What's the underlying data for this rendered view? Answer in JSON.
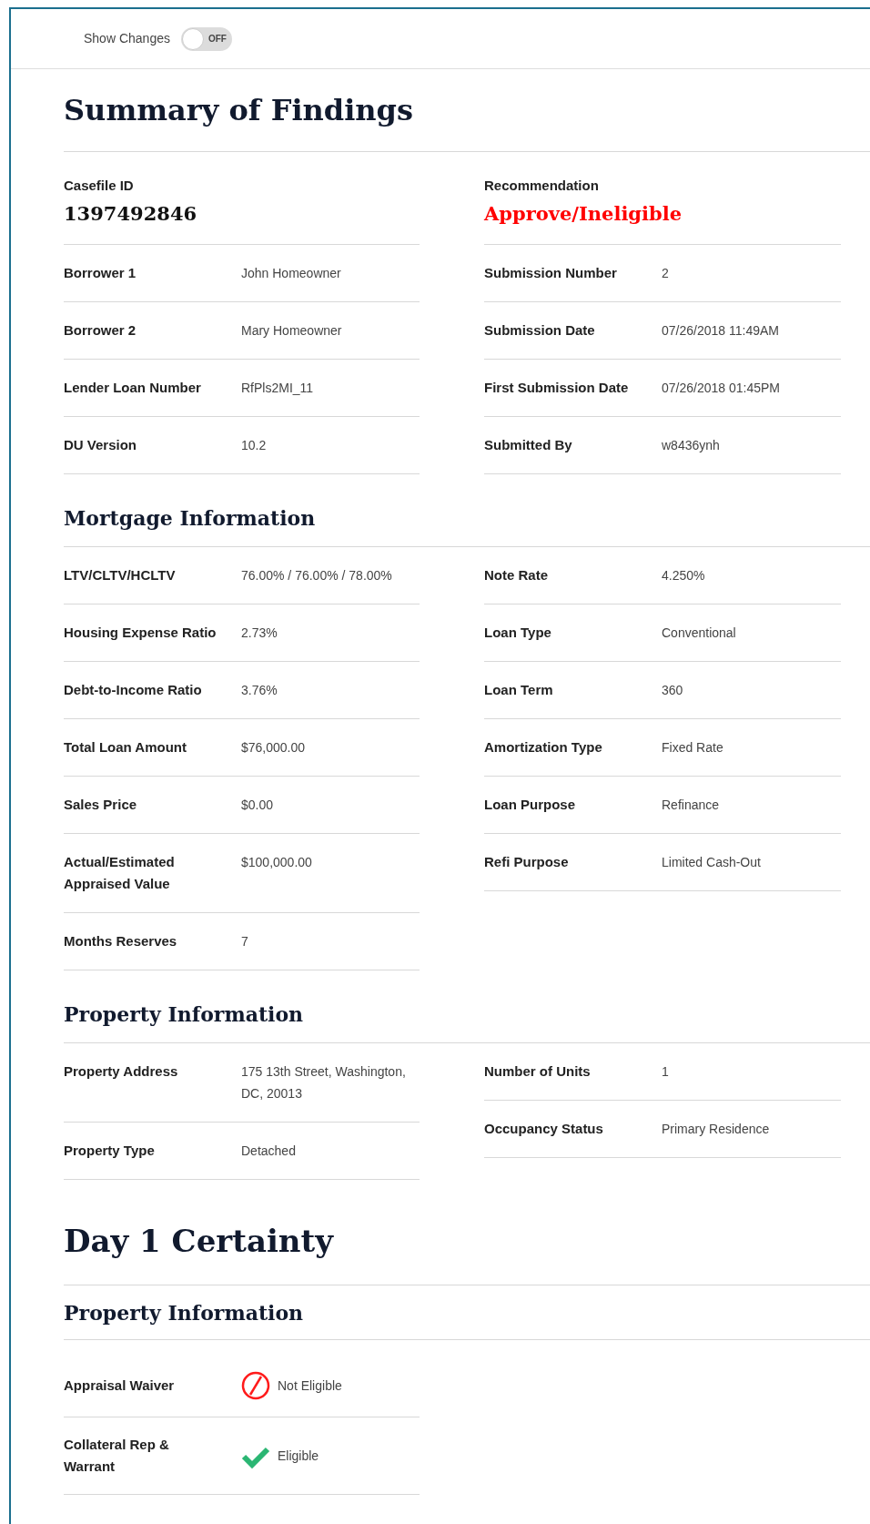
{
  "toggle": {
    "label": "Show Changes",
    "on": false,
    "state_text": "OFF"
  },
  "summary": {
    "title": "Summary of Findings",
    "casefile": {
      "label": "Casefile ID",
      "value": "1397492846"
    },
    "recommendation": {
      "label": "Recommendation",
      "value": "Approve/Ineligible"
    },
    "left_rows": [
      {
        "label": "Borrower 1",
        "value": "John Homeowner"
      },
      {
        "label": "Borrower 2",
        "value": "Mary Homeowner"
      },
      {
        "label": "Lender Loan Number",
        "value": "RfPls2MI_11"
      },
      {
        "label": "DU Version",
        "value": "10.2"
      }
    ],
    "right_rows": [
      {
        "label": "Submission Number",
        "value": "2"
      },
      {
        "label": "Submission Date",
        "value": "07/26/2018 11:49AM"
      },
      {
        "label": "First Submission Date",
        "value": "07/26/2018 01:45PM"
      },
      {
        "label": "Submitted By",
        "value": "w8436ynh"
      }
    ]
  },
  "sections": [
    {
      "title": "Mortgage Information",
      "left_rows": [
        {
          "label": "LTV/CLTV/HCLTV",
          "value": "76.00% / 76.00% / 78.00%"
        },
        {
          "label": "Housing Expense Ratio",
          "value": "2.73%"
        },
        {
          "label": "Debt-to-Income Ratio",
          "value": "3.76%"
        },
        {
          "label": "Total Loan Amount",
          "value": "$76,000.00"
        },
        {
          "label": "Sales Price",
          "value": "$0.00"
        },
        {
          "label": "Actual/Estimated Appraised Value",
          "value": "$100,000.00"
        },
        {
          "label": "Months Reserves",
          "value": "7"
        }
      ],
      "right_rows": [
        {
          "label": "Note Rate",
          "value": "4.250%"
        },
        {
          "label": "Loan Type",
          "value": "Conventional"
        },
        {
          "label": "Loan Term",
          "value": "360"
        },
        {
          "label": "Amortization Type",
          "value": "Fixed Rate"
        },
        {
          "label": "Loan Purpose",
          "value": "Refinance"
        },
        {
          "label": "Refi Purpose",
          "value": "Limited Cash-Out"
        }
      ]
    },
    {
      "title": "Property Information",
      "left_rows": [
        {
          "label": "Property Address",
          "value": "175 13th Street, Washington, DC, 20013"
        },
        {
          "label": "Property Type",
          "value": "Detached"
        }
      ],
      "right_rows": [
        {
          "label": "Number of Units",
          "value": "1"
        },
        {
          "label": "Occupancy Status",
          "value": "Primary Residence"
        }
      ]
    }
  ],
  "day1": {
    "title": "Day 1 Certainty",
    "subtitle": "Property Information",
    "rows": [
      {
        "label": "Appraisal Waiver",
        "value": "Not Eligible",
        "eligible": false
      },
      {
        "label": "Collateral Rep & Warrant",
        "value": "Eligible",
        "eligible": true
      }
    ]
  }
}
